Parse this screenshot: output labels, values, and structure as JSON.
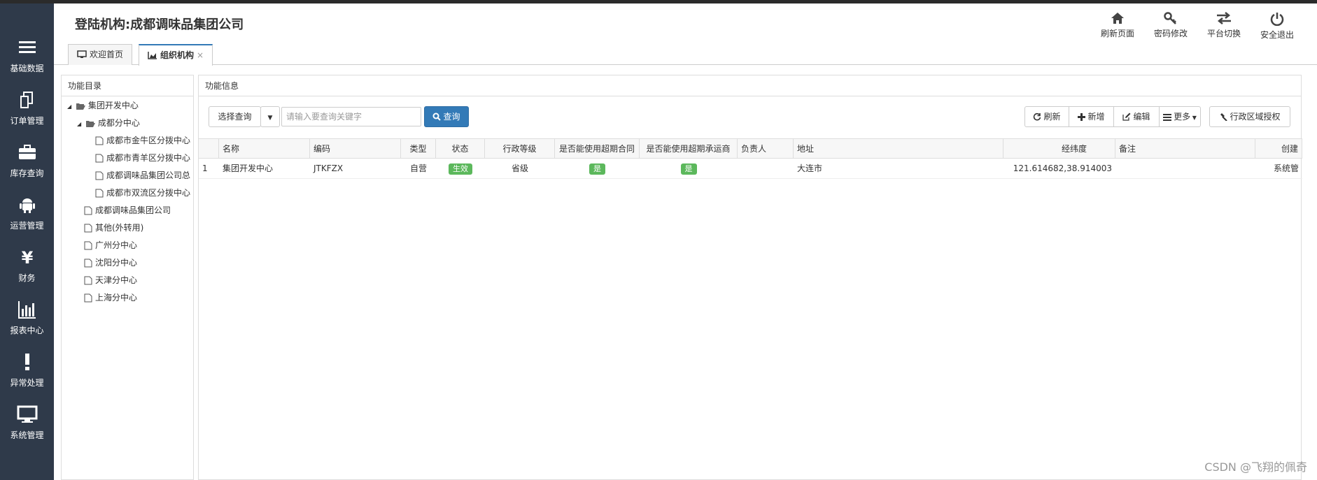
{
  "sidebar": {
    "items": [
      {
        "label": "基础数据",
        "icon": "menu-icon"
      },
      {
        "label": "订单管理",
        "icon": "copy-icon"
      },
      {
        "label": "库存查询",
        "icon": "briefcase-icon"
      },
      {
        "label": "运营管理",
        "icon": "android-icon"
      },
      {
        "label": "财务",
        "icon": "yen-icon"
      },
      {
        "label": "报表中心",
        "icon": "bar-chart-icon"
      },
      {
        "label": "异常处理",
        "icon": "exclamation-icon"
      },
      {
        "label": "系统管理",
        "icon": "desktop-icon"
      }
    ]
  },
  "header": {
    "org_title": "登陆机构:成都调味品集团公司",
    "actions": [
      {
        "label": "刷新页面",
        "icon": "home-icon"
      },
      {
        "label": "密码修改",
        "icon": "key-icon"
      },
      {
        "label": "平台切换",
        "icon": "swap-icon"
      },
      {
        "label": "安全退出",
        "icon": "power-icon"
      }
    ]
  },
  "tabs": [
    {
      "label": "欢迎首页",
      "icon": "monitor-icon"
    },
    {
      "label": "组织机构",
      "icon": "area-chart-icon",
      "close": "×"
    }
  ],
  "tree": {
    "title": "功能目录",
    "nodes": [
      {
        "label": "集团开发中心",
        "expanded": true
      },
      {
        "label": "成都分中心",
        "expanded": true
      },
      {
        "label": "成都市金牛区分拨中心"
      },
      {
        "label": "成都市青羊区分拨中心"
      },
      {
        "label": "成都调味品集团公司总"
      },
      {
        "label": "成都市双流区分拨中心"
      },
      {
        "label": "成都调味品集团公司"
      },
      {
        "label": "其他(外转用)"
      },
      {
        "label": "广州分中心"
      },
      {
        "label": "沈阳分中心"
      },
      {
        "label": "天津分中心"
      },
      {
        "label": "上海分中心"
      }
    ]
  },
  "main": {
    "title": "功能信息",
    "select_query": "选择查询",
    "search_placeholder": "请输入要查询关键字",
    "query_button": "查询",
    "toolbar": {
      "refresh": "刷新",
      "add": "新增",
      "edit": "编辑",
      "more": "更多",
      "region_auth": "行政区域授权"
    }
  },
  "table": {
    "headers": [
      "",
      "名称",
      "编码",
      "类型",
      "状态",
      "行政等级",
      "是否能使用超期合同",
      "是否能使用超期承运商",
      "负责人",
      "地址",
      "经纬度",
      "备注",
      "创建"
    ],
    "rows": [
      {
        "index": "1",
        "name": "集团开发中心",
        "code": "JTKFZX",
        "type": "自营",
        "status": "生效",
        "level": "省级",
        "overdue_contract": "是",
        "overdue_carrier": "是",
        "owner": "",
        "address": "大连市",
        "coords": "121.614682,38.914003",
        "remark": "",
        "creator": "系统管"
      }
    ]
  },
  "watermark": "CSDN @飞翔的佩奇",
  "colors": {
    "sidebar_bg": "#2f3a4a",
    "primary": "#337ab7",
    "success": "#5cb85c"
  }
}
